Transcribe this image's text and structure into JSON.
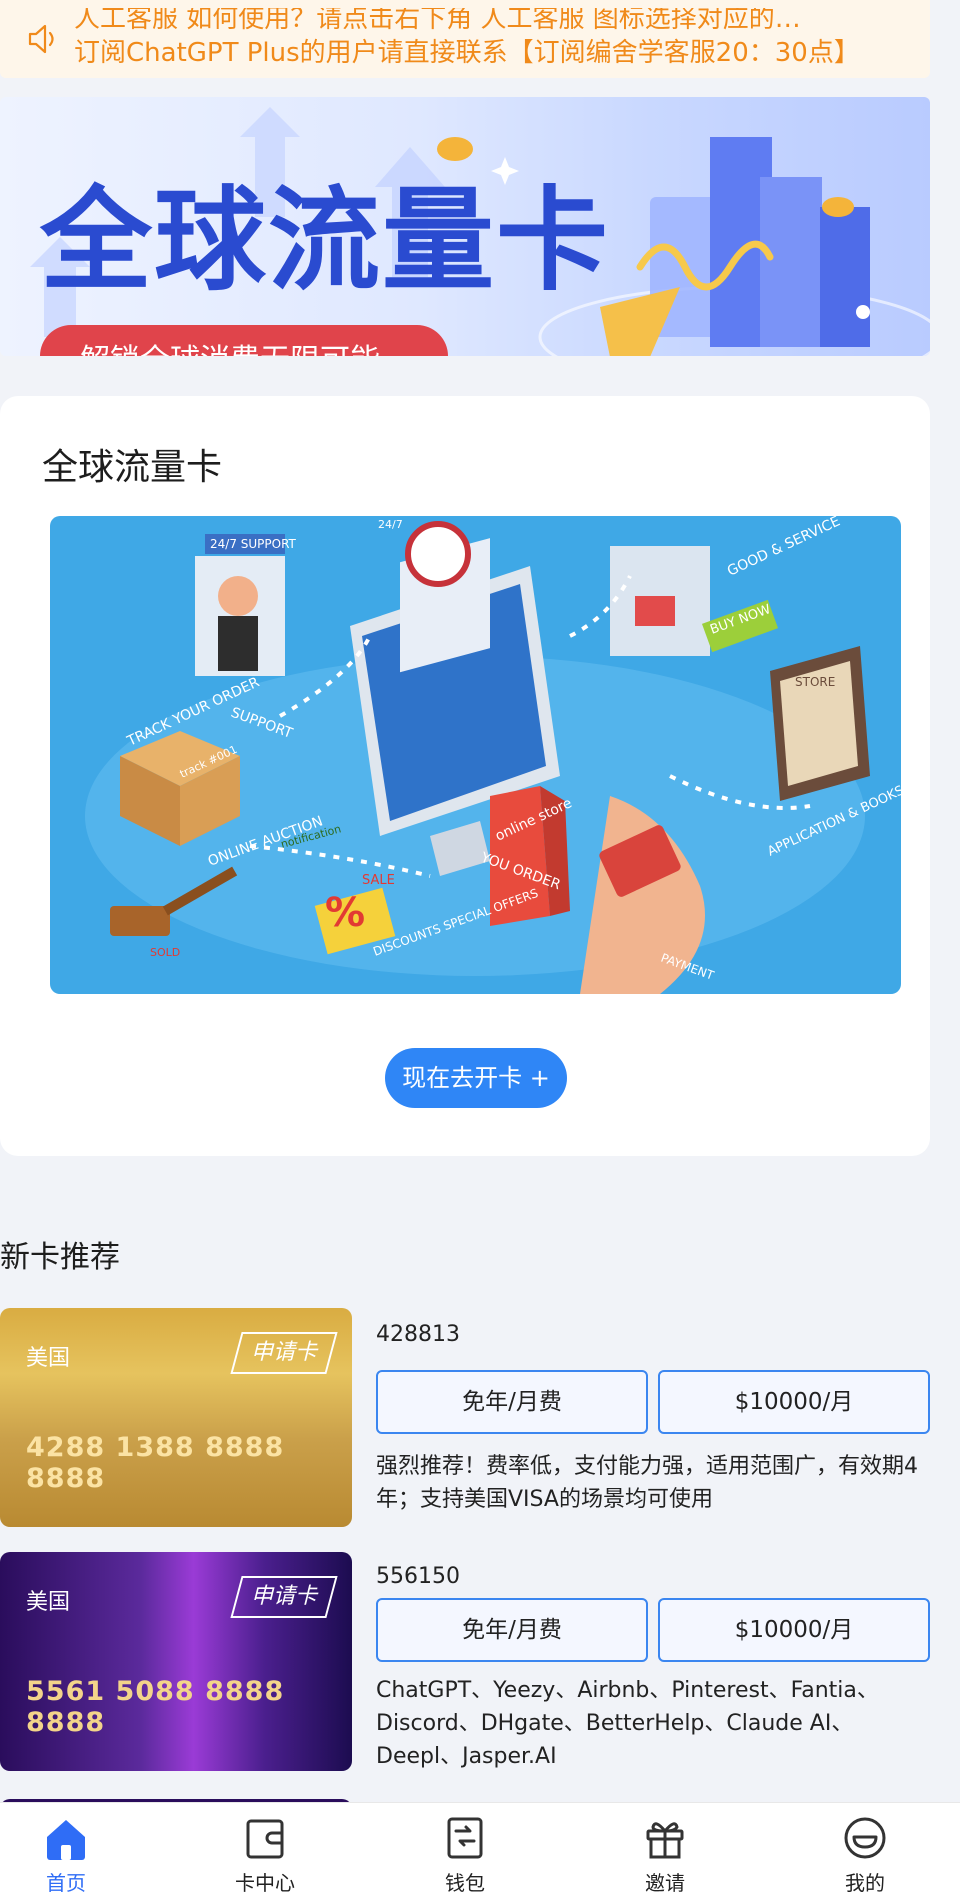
{
  "notice": {
    "icon": "speaker-icon",
    "line1": "人工客服  如何使用？请点击右下角  人工客服  图标选择对应的…",
    "line2": "订阅ChatGPT Plus的用户请直接联系【订阅编舍学客服20：30点】"
  },
  "banner": {
    "title": "全球流量卡",
    "subtitle": "解锁全球消费无限可能"
  },
  "main_card": {
    "title": "全球流量卡",
    "button": "现在去开卡 +",
    "illustration_texts": [
      "24/7 SUPPORT",
      "SUPPORT",
      "TRACK YOUR ORDER",
      "GOOD & SERVICE",
      "BUY NOW",
      "STORE",
      "APPLICATION & BOOKS STORE",
      "ONLINE AUCTION",
      "notification",
      "SALE",
      "YOU ORDER",
      "online store",
      "DISCOUNTS SPECIAL OFFERS",
      "PAYMENT",
      "SOLD",
      "track #001",
      "24/7"
    ]
  },
  "section": {
    "title": "新卡推荐"
  },
  "cards": [
    {
      "country": "美国",
      "apply_label": "申请卡",
      "number": "4288 1388 8888 8888",
      "code": "428813",
      "fee": "免年/月费",
      "limit": "$10000/月",
      "desc": "强烈推荐！费率低，支付能力强，适用范围广，有效期4年；支持美国VISA的场景均可使用"
    },
    {
      "country": "美国",
      "apply_label": "申请卡",
      "number": "5561 5088 8888 8888",
      "code": "556150",
      "fee": "免年/月费",
      "limit": "$10000/月",
      "desc": "ChatGPT、Yeezy、Airbnb、Pinterest、Fantia、Discord、DHgate、BetterHelp、Claude AI、Deepl、Jasper.AI"
    }
  ],
  "tabbar": {
    "active_color": "#2f6df6",
    "items": [
      {
        "label": "首页",
        "icon": "home-icon"
      },
      {
        "label": "卡中心",
        "icon": "card-center-icon"
      },
      {
        "label": "钱包",
        "icon": "wallet-icon"
      },
      {
        "label": "邀请",
        "icon": "gift-icon"
      },
      {
        "label": "我的",
        "icon": "profile-icon"
      }
    ]
  }
}
